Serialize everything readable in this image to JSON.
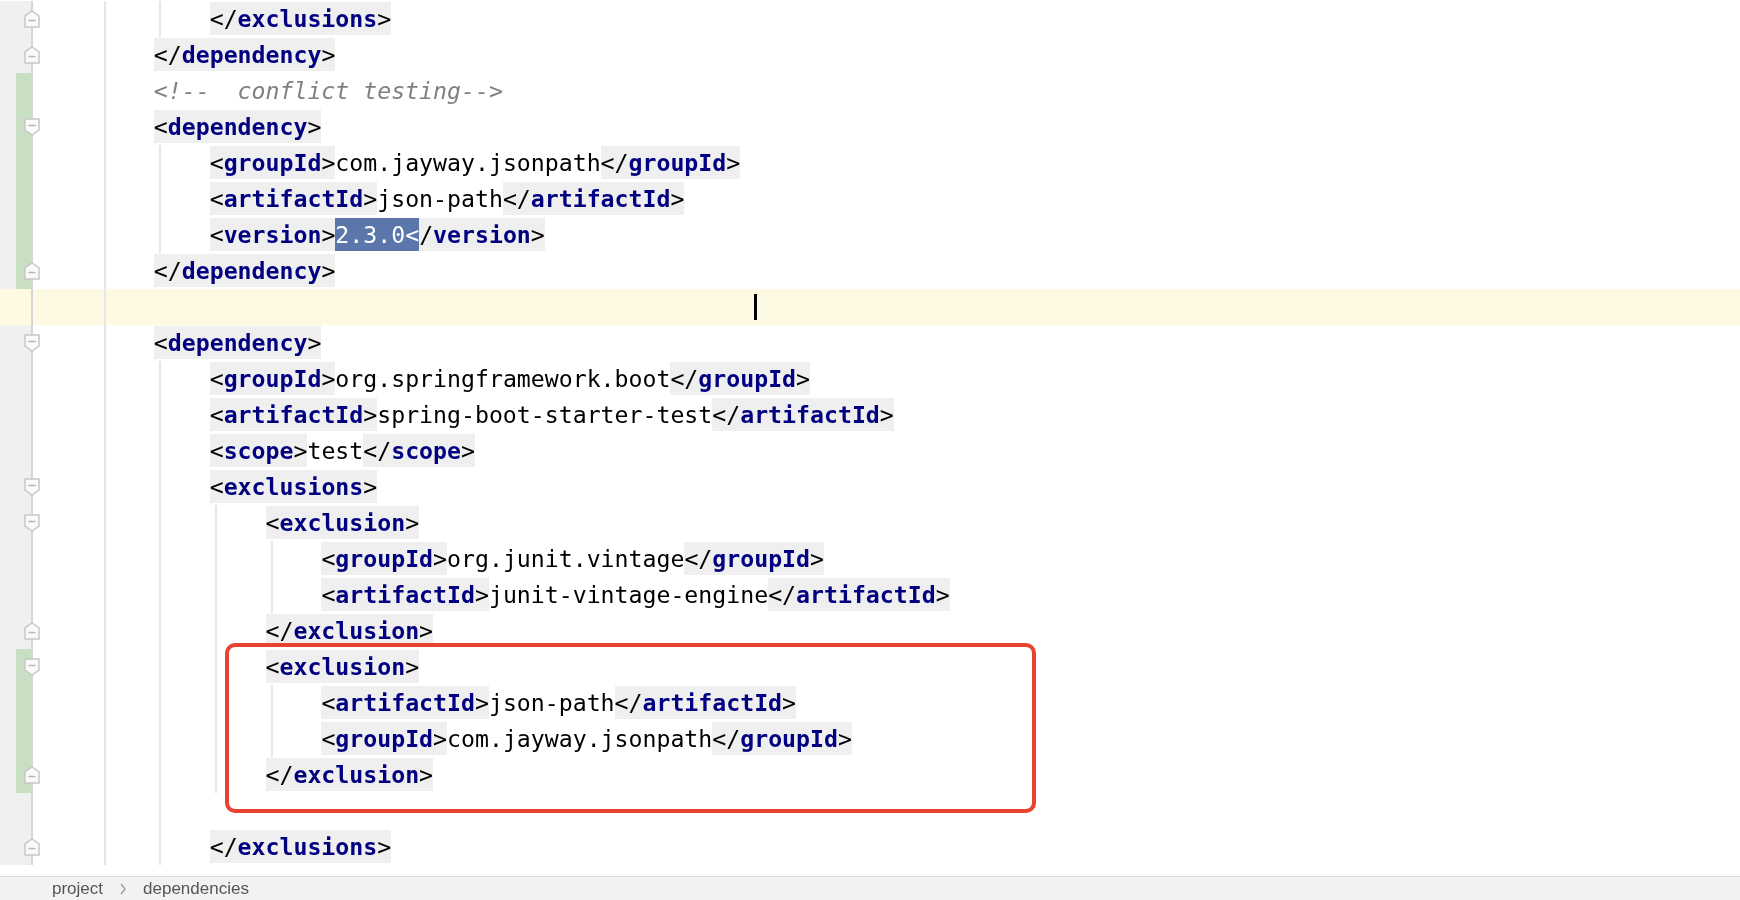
{
  "editor": {
    "lines": [
      {
        "segments": [
          {
            "text": "        </exclusions>"
          }
        ],
        "changed": false,
        "fold": {
          "kind": "end"
        }
      },
      {
        "segments": [
          {
            "text": "    </dependency>"
          }
        ],
        "changed": false,
        "fold": {
          "kind": "end"
        }
      },
      {
        "segments": [
          {
            "text": "    <!--  conflict testing-->"
          }
        ],
        "changed": true
      },
      {
        "segments": [
          {
            "text": "    <dependency>"
          }
        ],
        "changed": true,
        "fold": {
          "kind": "start"
        }
      },
      {
        "segments": [
          {
            "text": "        <groupId>com.jayway.jsonpath</groupId>"
          }
        ],
        "changed": true
      },
      {
        "segments": [
          {
            "text": "        <artifactId>json-path</artifactId>"
          }
        ],
        "changed": true
      },
      {
        "segments": [
          {
            "text": "        <version>"
          },
          {
            "text": "2.3.0<",
            "selected": true
          },
          {
            "text": "/version>"
          }
        ],
        "changed": true
      },
      {
        "segments": [
          {
            "text": "    </dependency>"
          }
        ],
        "changed": true,
        "fold": {
          "kind": "end"
        }
      },
      {
        "changed": false,
        "current": true,
        "caret": true
      },
      {
        "segments": [
          {
            "text": "    <dependency>"
          }
        ],
        "changed": false,
        "fold": {
          "kind": "start"
        }
      },
      {
        "segments": [
          {
            "text": "        <groupId>org.springframework.boot</groupId>"
          }
        ],
        "changed": false
      },
      {
        "segments": [
          {
            "text": "        <artifactId>spring-boot-starter-test</artifactId>"
          }
        ],
        "changed": false
      },
      {
        "segments": [
          {
            "text": "        <scope>test</scope>"
          }
        ],
        "changed": false
      },
      {
        "segments": [
          {
            "text": "        <exclusions>"
          }
        ],
        "changed": false,
        "fold": {
          "kind": "start"
        }
      },
      {
        "segments": [
          {
            "text": "            <exclusion>"
          }
        ],
        "changed": false,
        "fold": {
          "kind": "start"
        }
      },
      {
        "segments": [
          {
            "text": "                <groupId>org.junit.vintage</groupId>"
          }
        ],
        "changed": false
      },
      {
        "segments": [
          {
            "text": "                <artifactId>junit-vintage-engine</artifactId>"
          }
        ],
        "changed": false
      },
      {
        "segments": [
          {
            "text": "            </exclusion>"
          }
        ],
        "changed": false,
        "fold": {
          "kind": "end"
        }
      },
      {
        "segments": [
          {
            "text": "            <exclusion>"
          }
        ],
        "changed": true,
        "annotated": true,
        "fold": {
          "kind": "start"
        }
      },
      {
        "segments": [
          {
            "text": "                <artifactId>json-path</artifactId>"
          }
        ],
        "changed": true,
        "annotated": true
      },
      {
        "segments": [
          {
            "text": "                <groupId>com.jayway.jsonpath</groupId>"
          }
        ],
        "changed": true,
        "annotated": true
      },
      {
        "segments": [
          {
            "text": "            </exclusion>"
          }
        ],
        "changed": true,
        "annotated": true,
        "fold": {
          "kind": "end"
        }
      },
      {
        "changed": false
      },
      {
        "segments": [
          {
            "text": "        </exclusions>"
          }
        ],
        "changed": false,
        "fold": {
          "kind": "end"
        }
      }
    ]
  },
  "breadcrumb": [
    "project",
    "dependencies"
  ]
}
